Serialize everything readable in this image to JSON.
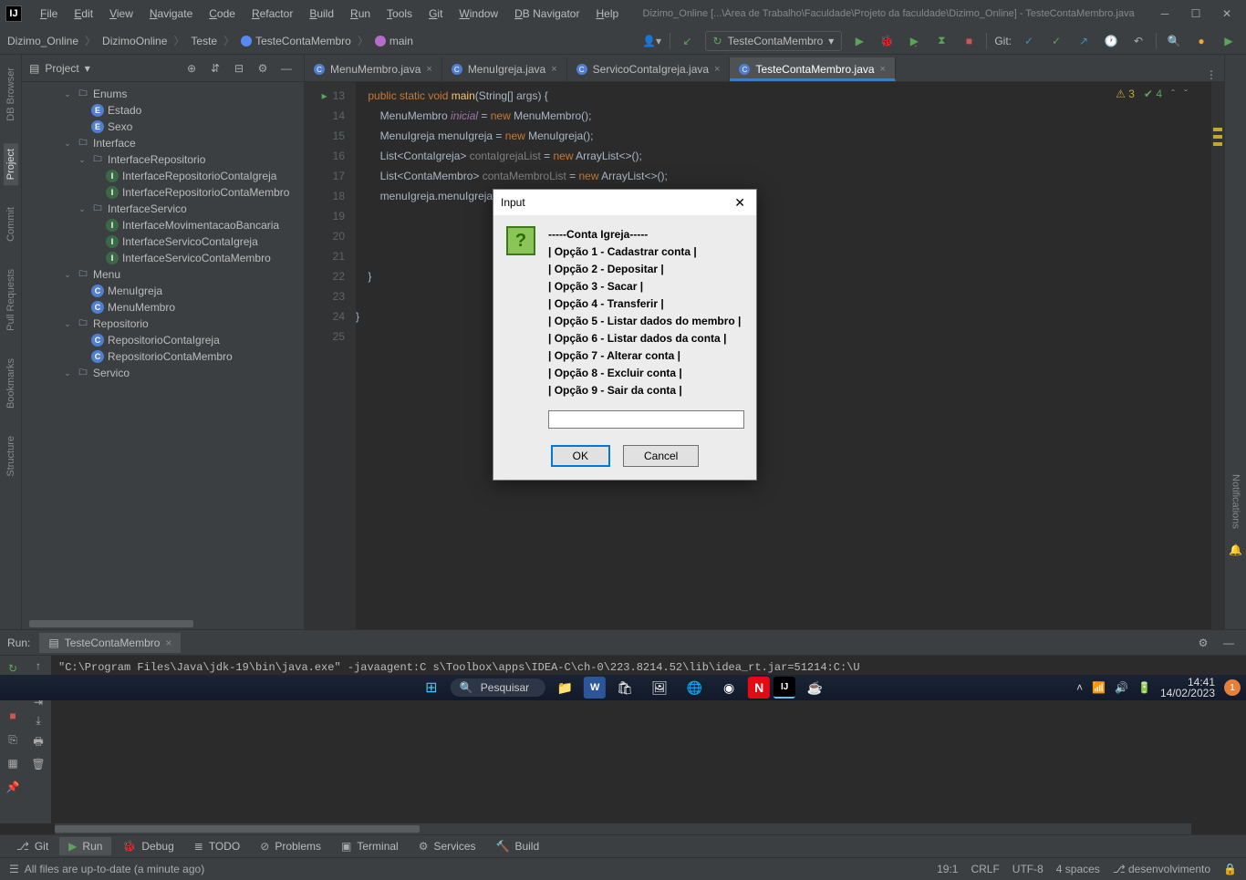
{
  "title": "Dizimo_Online [...\\Área de Trabalho\\Faculdade\\Projeto da faculdade\\Dizimo_Online] - TesteContaMembro.java",
  "menus": [
    "File",
    "Edit",
    "View",
    "Navigate",
    "Code",
    "Refactor",
    "Build",
    "Run",
    "Tools",
    "Git",
    "Window",
    "DB Navigator",
    "Help"
  ],
  "breadcrumb": {
    "project": "Dizimo_Online",
    "pkg": "DizimoOnline",
    "sub": "Teste",
    "cls": "TesteContaMembro",
    "method": "main"
  },
  "runConfig": "TesteContaMembro",
  "gitLabel": "Git:",
  "leftTabs": [
    "DB Browser",
    "Project",
    "Commit",
    "Pull Requests",
    "Bookmarks",
    "Structure"
  ],
  "rightTab": "Notifications",
  "projectPanel": {
    "title": "Project"
  },
  "tree": [
    {
      "d": 2,
      "a": "v",
      "ic": "folder",
      "t": "Enums"
    },
    {
      "d": 3,
      "a": "",
      "ic": "enum",
      "t": "Estado",
      "c": "E"
    },
    {
      "d": 3,
      "a": "",
      "ic": "enum",
      "t": "Sexo",
      "c": "E"
    },
    {
      "d": 2,
      "a": "v",
      "ic": "folder",
      "t": "Interface"
    },
    {
      "d": 3,
      "a": "v",
      "ic": "folder",
      "t": "InterfaceRepositorio"
    },
    {
      "d": 4,
      "a": "",
      "ic": "iface",
      "t": "InterfaceRepositorioContaIgreja",
      "c": "I"
    },
    {
      "d": 4,
      "a": "",
      "ic": "iface",
      "t": "InterfaceRepositorioContaMembro",
      "c": "I"
    },
    {
      "d": 3,
      "a": "v",
      "ic": "folder",
      "t": "InterfaceServico"
    },
    {
      "d": 4,
      "a": "",
      "ic": "iface",
      "t": "InterfaceMovimentacaoBancaria",
      "c": "I"
    },
    {
      "d": 4,
      "a": "",
      "ic": "iface",
      "t": "InterfaceServicoContaIgreja",
      "c": "I"
    },
    {
      "d": 4,
      "a": "",
      "ic": "iface",
      "t": "InterfaceServicoContaMembro",
      "c": "I"
    },
    {
      "d": 2,
      "a": "v",
      "ic": "folder",
      "t": "Menu"
    },
    {
      "d": 3,
      "a": "",
      "ic": "blue",
      "t": "MenuIgreja",
      "c": "C"
    },
    {
      "d": 3,
      "a": "",
      "ic": "blue",
      "t": "MenuMembro",
      "c": "C"
    },
    {
      "d": 2,
      "a": "v",
      "ic": "folder",
      "t": "Repositorio"
    },
    {
      "d": 3,
      "a": "",
      "ic": "blue",
      "t": "RepositorioContaIgreja",
      "c": "C"
    },
    {
      "d": 3,
      "a": "",
      "ic": "blue",
      "t": "RepositorioContaMembro",
      "c": "C"
    },
    {
      "d": 2,
      "a": "v",
      "ic": "folder",
      "t": "Servico"
    }
  ],
  "editorTabs": [
    {
      "name": "MenuMembro.java"
    },
    {
      "name": "MenuIgreja.java"
    },
    {
      "name": "ServicoContaIgreja.java"
    },
    {
      "name": "TesteContaMembro.java",
      "active": true
    }
  ],
  "lineNumbers": [
    "13",
    "14",
    "15",
    "16",
    "17",
    "18",
    "19",
    "20",
    "21",
    "22",
    "23",
    "24",
    "25"
  ],
  "inspections": {
    "warn": "3",
    "ok": "4"
  },
  "runTab": {
    "label": "Run:",
    "config": "TesteContaMembro"
  },
  "console": "\"C:\\Program Files\\Java\\jdk-19\\bin\\java.exe\" -javaagent:C                                            s\\Toolbox\\apps\\IDEA-C\\ch-0\\223.8214.52\\lib\\idea_rt.jar=51214:C:\\U",
  "bottomTabs": [
    {
      "icon": "⎇",
      "label": "Git"
    },
    {
      "icon": "▶",
      "label": "Run",
      "active": true,
      "iconColor": "#5aa55a"
    },
    {
      "icon": "🐞",
      "label": "Debug"
    },
    {
      "icon": "≣",
      "label": "TODO"
    },
    {
      "icon": "⊘",
      "label": "Problems"
    },
    {
      "icon": "▣",
      "label": "Terminal"
    },
    {
      "icon": "⚙",
      "label": "Services"
    },
    {
      "icon": "🔨",
      "label": "Build"
    }
  ],
  "status": {
    "msg": "All files are up-to-date (a minute ago)",
    "pos": "19:1",
    "sep": "CRLF",
    "enc": "UTF-8",
    "indent": "4 spaces",
    "branch": "desenvolvimento"
  },
  "dialog": {
    "title": "Input",
    "lines": [
      "-----Conta Igreja-----",
      "| Opção 1 - Cadastrar conta |",
      "| Opção 2 - Depositar |",
      "| Opção 3 - Sacar |",
      "| Opção 4 - Transferir |",
      "| Opção 5 - Listar dados do membro |",
      "| Opção 6 - Listar dados da conta |",
      "| Opção 7 - Alterar conta |",
      "| Opção 8 - Excluir conta |",
      "| Opção 9 - Sair da conta |"
    ],
    "ok": "OK",
    "cancel": "Cancel",
    "input": ""
  },
  "taskbar": {
    "search": "Pesquisar",
    "time": "14:41",
    "date": "14/02/2023",
    "badge": "1"
  }
}
